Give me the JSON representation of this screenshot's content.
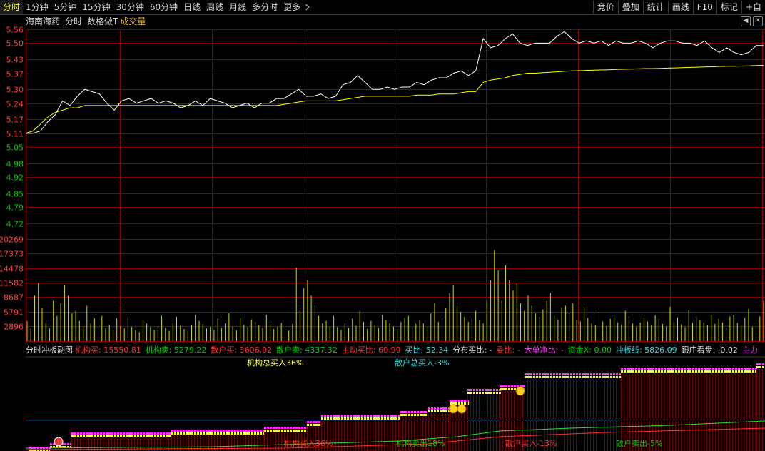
{
  "toolbar": {
    "tabs": [
      {
        "label": "分时",
        "active": true
      },
      {
        "label": "1分钟"
      },
      {
        "label": "5分钟"
      },
      {
        "label": "15分钟"
      },
      {
        "label": "30分钟"
      },
      {
        "label": "60分钟"
      },
      {
        "label": "日线"
      },
      {
        "label": "周线"
      },
      {
        "label": "月线"
      },
      {
        "label": "多分时"
      },
      {
        "label": "更多"
      }
    ],
    "right_buttons": [
      "竞价",
      "叠加",
      "统计",
      "画线",
      "F10",
      "标记",
      "+自"
    ]
  },
  "chart_title": {
    "stock_name": "海南海药",
    "mode": "分时",
    "indicator": "数格做T",
    "volume_label": "成交量"
  },
  "colors": {
    "price_line": "#ffffff",
    "avg_line": "#ffff00",
    "grid": "#8b0000",
    "up": "#ff3030",
    "down": "#00d000",
    "volume": "#d8d800",
    "axis_text": "#ff4040",
    "axis_text_down": "#00d000"
  },
  "chart_data": [
    {
      "type": "line",
      "y_axis_ticks": [
        "5.56",
        "5.50",
        "5.43",
        "5.37",
        "5.30",
        "5.24",
        "5.17",
        "5.11",
        "5.05",
        "4.98",
        "4.92",
        "4.85",
        "4.79",
        "4.72"
      ],
      "ylim": [
        4.72,
        5.56
      ],
      "prev_close": 5.11,
      "series": [
        {
          "values": [
            5.11,
            5.11,
            5.12,
            5.16,
            5.19,
            5.25,
            5.23,
            5.27,
            5.3,
            5.29,
            5.28,
            5.24,
            5.21,
            5.25,
            5.26,
            5.24,
            5.25,
            5.26,
            5.24,
            5.25,
            5.24,
            5.22,
            5.23,
            5.25,
            5.23,
            5.26,
            5.25,
            5.24,
            5.22,
            5.23,
            5.24,
            5.22,
            5.24,
            5.24,
            5.26,
            5.26,
            5.28,
            5.3,
            5.27,
            5.27,
            5.28,
            5.26,
            5.27,
            5.32,
            5.33,
            5.36,
            5.33,
            5.3,
            5.3,
            5.31,
            5.3,
            5.31,
            5.31,
            5.33,
            5.32,
            5.34,
            5.35,
            5.35,
            5.37,
            5.38,
            5.36,
            5.38,
            5.52,
            5.48,
            5.49,
            5.52,
            5.54,
            5.5,
            5.49,
            5.5,
            5.5,
            5.5,
            5.53,
            5.55,
            5.52,
            5.5,
            5.51,
            5.5,
            5.51,
            5.49,
            5.51,
            5.5,
            5.5,
            5.51,
            5.5,
            5.48,
            5.5,
            5.51,
            5.51,
            5.5,
            5.5,
            5.49,
            5.51,
            5.48,
            5.46,
            5.48,
            5.46,
            5.45,
            5.46,
            5.49,
            5.49
          ]
        },
        {
          "values": [
            5.11,
            5.12,
            5.15,
            5.18,
            5.2,
            5.21,
            5.22,
            5.22,
            5.23,
            5.23,
            5.23,
            5.23,
            5.23,
            5.23,
            5.23,
            5.23,
            5.23,
            5.23,
            5.23,
            5.23,
            5.23,
            5.23,
            5.23,
            5.23,
            5.23,
            5.23,
            5.23,
            5.23,
            5.23,
            5.23,
            5.23,
            5.23,
            5.23,
            5.23,
            5.23,
            5.235,
            5.24,
            5.245,
            5.25,
            5.25,
            5.25,
            5.25,
            5.25,
            5.255,
            5.26,
            5.265,
            5.27,
            5.27,
            5.27,
            5.27,
            5.27,
            5.27,
            5.27,
            5.275,
            5.275,
            5.275,
            5.28,
            5.28,
            5.28,
            5.285,
            5.29,
            5.29,
            5.33,
            5.34,
            5.345,
            5.35,
            5.36,
            5.365,
            5.37,
            5.37,
            5.372,
            5.374,
            5.376,
            5.378,
            5.38,
            5.381,
            5.382,
            5.383,
            5.384,
            5.385,
            5.386,
            5.387,
            5.388,
            5.389,
            5.39,
            5.39,
            5.391,
            5.392,
            5.393,
            5.394,
            5.395,
            5.396,
            5.397,
            5.398,
            5.399,
            5.4,
            5.4,
            5.401,
            5.402,
            5.403,
            5.404
          ]
        }
      ]
    },
    {
      "type": "bar",
      "y_axis_ticks": [
        "20269",
        "17373",
        "14478",
        "11582",
        "8687",
        "5791",
        "2896"
      ],
      "ylim": [
        0,
        23165
      ],
      "values": [
        4000,
        2500,
        9000,
        11500,
        6500,
        3500,
        2500,
        8000,
        5000,
        7500,
        11000,
        9000,
        5500,
        6000,
        4000,
        3000,
        7000,
        3500,
        4500,
        3000,
        5000,
        2500,
        3200,
        2200,
        4500,
        3000,
        2500,
        5000,
        2800,
        2200,
        1800,
        4200,
        3500,
        2800,
        2200,
        3000,
        5000,
        2600,
        2000,
        3500,
        4800,
        3000,
        2400,
        2000,
        3100,
        5200,
        4000,
        3300,
        2500,
        2800,
        2200,
        4500,
        2600,
        3500,
        5500,
        3000,
        2100,
        4600,
        3200,
        2800,
        4300,
        3800,
        3100,
        2600,
        5200,
        3300,
        2400,
        2900,
        3600,
        2800,
        2100,
        3400,
        14500,
        6000,
        10500,
        12000,
        9000,
        7000,
        5000,
        3500,
        4000,
        3000,
        5000,
        2800,
        2200,
        3500,
        2600,
        4500,
        3000,
        6000,
        3800,
        2400,
        4000,
        3100,
        2600,
        5200,
        4200,
        3500,
        2900,
        2400,
        3800,
        4600,
        5000,
        2800,
        3400,
        4200,
        3500,
        2900,
        5500,
        7500,
        3800,
        4600,
        6500,
        9500,
        11000,
        7000,
        5800,
        4800,
        3800,
        5000,
        6000,
        4200,
        3500,
        8000,
        12000,
        18000,
        14000,
        8000,
        15000,
        12000,
        10000,
        11500,
        7500,
        6000,
        9000,
        7000,
        5500,
        4800,
        6300,
        8000,
        9500,
        5000,
        4300,
        6600,
        7000,
        5500,
        7500,
        4200,
        3900,
        6800,
        4600,
        3500,
        3100,
        5800,
        3900,
        3000,
        4400,
        5200,
        3700,
        3300,
        6000,
        4900,
        3500,
        2800,
        3700,
        4600,
        3900,
        3100,
        5100,
        4300,
        3400,
        2900,
        6800,
        3800,
        4700,
        3300,
        2800,
        6100,
        3600,
        4900,
        4200,
        3700,
        3100,
        5300,
        3400,
        4400,
        3700,
        2700,
        4900,
        5200,
        3600,
        3100,
        4600,
        6400,
        2800,
        3700,
        4900,
        8000
      ]
    }
  ],
  "indicator": {
    "name": "分时冲板副图",
    "fields": [
      {
        "label": "机构买",
        "value": "15550.81",
        "color": "#ff3030"
      },
      {
        "label": "机构卖",
        "value": "5279.22",
        "color": "#00d000"
      },
      {
        "label": "散户买",
        "value": "3606.02",
        "color": "#ff3030"
      },
      {
        "label": "散户卖",
        "value": "4337.32",
        "color": "#00d000"
      },
      {
        "label": "主动买比",
        "value": "60.99",
        "color": "#ff3030"
      },
      {
        "label": "买比",
        "value": "52.34",
        "color": "#30e0e0"
      },
      {
        "label": "分布买比",
        "value": "-",
        "color": "#e0e0e0"
      },
      {
        "label": "委比",
        "value": "-",
        "color": "#ff3030"
      },
      {
        "label": "大单净比",
        "value": "-",
        "color": "#ff40ff"
      },
      {
        "label": "资金X",
        "value": "0.00",
        "color": "#00d000"
      },
      {
        "label": "冲板线",
        "value": "5826.09",
        "color": "#30e0e0"
      },
      {
        "label": "跟庄看盘",
        "value": ".0.02",
        "color": "#e0e0e0"
      },
      {
        "label": "主力",
        "value": "",
        "color": "#ff40ff"
      }
    ],
    "labels": {
      "inst_total": "机构总买入36%",
      "retail_total": "散户总买入-3%",
      "b1": "机构卖出18%",
      "b2": "散户买入-13%",
      "b3": "散户卖出-5%",
      "b0": "机构买入36%"
    }
  }
}
